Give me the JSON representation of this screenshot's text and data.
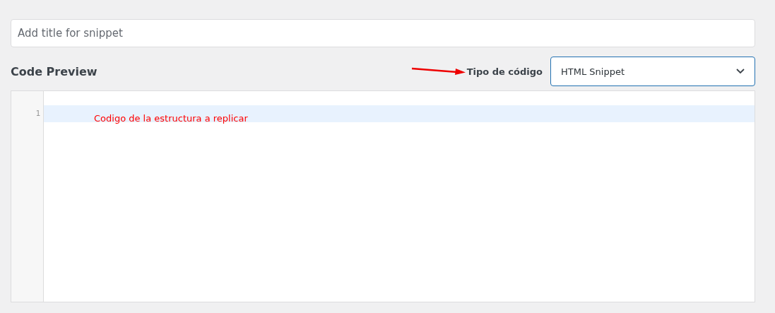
{
  "title_field": {
    "placeholder": "Add title for snippet"
  },
  "section_title": "Code Preview",
  "code_type": {
    "label": "Tipo de código",
    "value": "HTML Snippet"
  },
  "editor": {
    "lines": [
      {
        "number": "1",
        "text": "Codigo de la estructura a replicar",
        "selected": true
      }
    ]
  }
}
